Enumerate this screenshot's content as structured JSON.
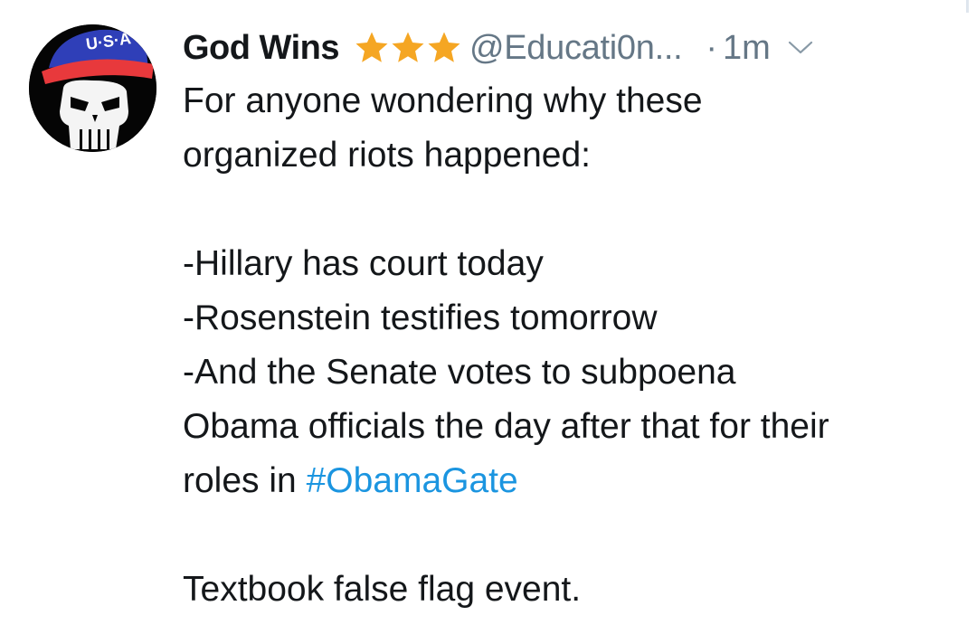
{
  "tweet": {
    "avatar_icon": "punisher-skull-usa-cap-icon",
    "avatar_cap_text": "U·S·A",
    "display_name": "God Wins",
    "badge_icons": [
      "star-icon",
      "star-icon",
      "star-icon"
    ],
    "star_color": "#f5a623",
    "handle": "@Educati0n...",
    "separator": "·",
    "timestamp": "1m",
    "menu_icon": "chevron-down-icon",
    "lines": [
      "For anyone wondering why these",
      "organized riots happened:",
      "",
      "-Hillary has court today",
      "-Rosenstein testifies tomorrow",
      "-And the Senate votes to subpoena",
      "Obama officials the day after that for their",
      "roles in "
    ],
    "hashtag": "#ObamaGate",
    "hashtag_color": "#1b95e0",
    "closing_line": "Textbook false flag event."
  }
}
